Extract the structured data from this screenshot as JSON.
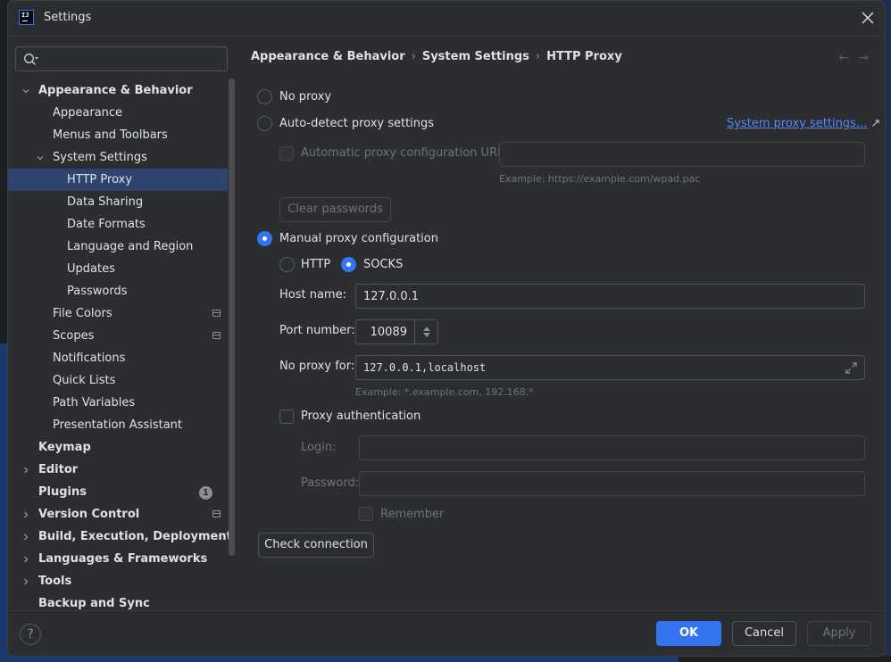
{
  "window": {
    "title": "Settings",
    "app_icon_text": "IJ",
    "close_icon": "close-icon"
  },
  "sidebar": {
    "search_placeholder": "",
    "items": [
      {
        "label": "Appearance & Behavior",
        "level": 0,
        "bold": true,
        "chevron": "down"
      },
      {
        "label": "Appearance",
        "level": 1
      },
      {
        "label": "Menus and Toolbars",
        "level": 1
      },
      {
        "label": "System Settings",
        "level": 1,
        "chevron": "down"
      },
      {
        "label": "HTTP Proxy",
        "level": 2,
        "selected": true
      },
      {
        "label": "Data Sharing",
        "level": 2
      },
      {
        "label": "Date Formats",
        "level": 2
      },
      {
        "label": "Language and Region",
        "level": 2
      },
      {
        "label": "Updates",
        "level": 2
      },
      {
        "label": "Passwords",
        "level": 2
      },
      {
        "label": "File Colors",
        "level": 1,
        "project_icon": true
      },
      {
        "label": "Scopes",
        "level": 1,
        "project_icon": true
      },
      {
        "label": "Notifications",
        "level": 1
      },
      {
        "label": "Quick Lists",
        "level": 1
      },
      {
        "label": "Path Variables",
        "level": 1
      },
      {
        "label": "Presentation Assistant",
        "level": 1
      },
      {
        "label": "Keymap",
        "level": 0,
        "bold": true
      },
      {
        "label": "Editor",
        "level": 0,
        "bold": true,
        "chevron": "right"
      },
      {
        "label": "Plugins",
        "level": 0,
        "bold": true,
        "badge": "1"
      },
      {
        "label": "Version Control",
        "level": 0,
        "bold": true,
        "chevron": "right",
        "project_icon": true
      },
      {
        "label": "Build, Execution, Deployment",
        "level": 0,
        "bold": true,
        "chevron": "right"
      },
      {
        "label": "Languages & Frameworks",
        "level": 0,
        "bold": true,
        "chevron": "right"
      },
      {
        "label": "Tools",
        "level": 0,
        "bold": true,
        "chevron": "right"
      },
      {
        "label": "Backup and Sync",
        "level": 0,
        "bold": true
      }
    ]
  },
  "breadcrumb": {
    "items": [
      "Appearance & Behavior",
      "System Settings",
      "HTTP Proxy"
    ],
    "separator": "›",
    "back_arrow": "←",
    "forward_arrow": "→"
  },
  "proxy": {
    "no_proxy_label": "No proxy",
    "auto_detect_label": "Auto-detect proxy settings",
    "system_proxy_link": "System proxy settings...",
    "system_proxy_link_icon": "↗",
    "auto_config_url_label": "Automatic proxy configuration URL:",
    "auto_config_url_value": "",
    "auto_config_url_hint": "Example: https://example.com/wpad.pac",
    "clear_passwords_label": "Clear passwords",
    "manual_label": "Manual proxy configuration",
    "selected_mode": "manual",
    "http_label": "HTTP",
    "socks_label": "SOCKS",
    "selected_protocol": "SOCKS",
    "host_name_label": "Host name:",
    "host_name_value": "127.0.0.1",
    "port_label": "Port number:",
    "port_value": "10089",
    "no_proxy_for_label": "No proxy for:",
    "no_proxy_for_value": "127.0.0.1,localhost",
    "no_proxy_for_hint": "Example: *.example.com, 192.168.*",
    "proxy_auth_label": "Proxy authentication",
    "proxy_auth_checked": false,
    "login_label": "Login:",
    "login_value": "",
    "password_label": "Password:",
    "password_value": "",
    "remember_label": "Remember",
    "check_connection_label": "Check connection"
  },
  "footer": {
    "help_label": "?",
    "ok_label": "OK",
    "cancel_label": "Cancel",
    "apply_label": "Apply"
  },
  "colors": {
    "accent": "#3574f0",
    "link": "#548af7",
    "selection": "#2e436e",
    "background": "#2b2d30"
  }
}
